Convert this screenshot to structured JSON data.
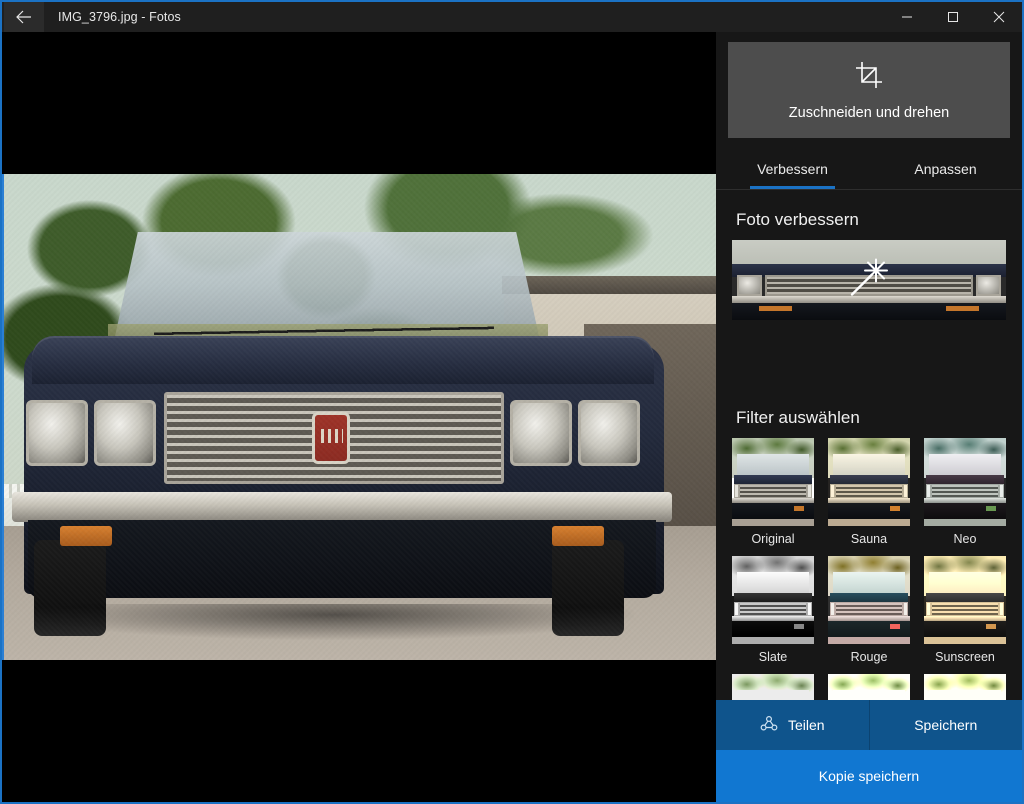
{
  "window": {
    "title": "IMG_3796.jpg - Fotos",
    "back_icon": "back-arrow-icon",
    "minimize_label": "–",
    "maximize_label": "□",
    "close_label": "✕",
    "accent_color": "#1b72c4",
    "titlebar_color": "#1f1f1f"
  },
  "editor": {
    "crop_button": {
      "label": "Zuschneiden und drehen",
      "icon": "crop-icon"
    },
    "tabs": [
      {
        "label": "Verbessern",
        "active": true
      },
      {
        "label": "Anpassen",
        "active": false
      }
    ],
    "enhance": {
      "title": "Foto verbessern",
      "icon": "magic-wand-icon"
    },
    "filters": {
      "title": "Filter auswählen",
      "items": [
        {
          "name": "Original",
          "selected": true
        },
        {
          "name": "Sauna",
          "selected": false
        },
        {
          "name": "Neo",
          "selected": false
        },
        {
          "name": "Slate",
          "selected": false
        },
        {
          "name": "Rouge",
          "selected": false
        },
        {
          "name": "Sunscreen",
          "selected": false
        }
      ]
    }
  },
  "actions": {
    "share": {
      "label": "Teilen",
      "icon": "share-icon"
    },
    "save": {
      "label": "Speichern"
    },
    "save_copy": {
      "label": "Kopie speichern",
      "color": "#1177d1"
    }
  },
  "photo": {
    "alt": "Vintage dark blue Fiat car front view with chrome grille parked on gravel driveway, trees and garage in background"
  }
}
